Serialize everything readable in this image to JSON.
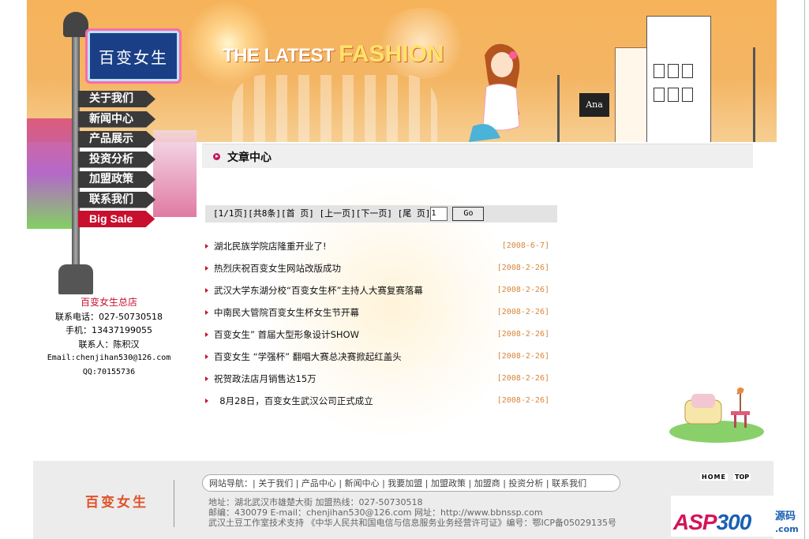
{
  "banner": {
    "tagline_a": "THE LATEST",
    "tagline_b": "FASHION",
    "shop_sign": "Ana"
  },
  "logo": {
    "text": "百变女生"
  },
  "nav": [
    {
      "label": "关于我们"
    },
    {
      "label": "新闻中心"
    },
    {
      "label": "产品展示"
    },
    {
      "label": "投资分析"
    },
    {
      "label": "加盟政策"
    },
    {
      "label": "联系我们"
    },
    {
      "label": "Big Sale"
    }
  ],
  "contact": {
    "name": "百变女生总店",
    "phone": "联系电话：027-50730518",
    "mobile": "手机：13437199055",
    "person": "联系人：陈积汉",
    "email": "Email:chenjihan530@126.com",
    "qq": "QQ:70155736"
  },
  "section": {
    "title": "文章中心"
  },
  "pager": {
    "text": "[1/1页][共8条][首 页] [上一页][下一页] [尾 页]",
    "input_value": "1",
    "go_label": "Go"
  },
  "articles": [
    {
      "title": "湖北民族学院店隆重开业了!",
      "date": "[2008-6-7]"
    },
    {
      "title": "热烈庆祝百变女生网站改版成功",
      "date": "[2008-2-26]"
    },
    {
      "title": "武汉大学东湖分校“百变女生杯”主持人大赛复赛落幕",
      "date": "[2008-2-26]"
    },
    {
      "title": "中南民大管院百变女生杯女生节开幕",
      "date": "[2008-2-26]"
    },
    {
      "title": "百变女生” 首届大型形象设计SHOW",
      "date": "[2008-2-26]"
    },
    {
      "title": "百变女生 “学强杯” 翻唱大赛总决赛掀起红盖头",
      "date": "[2008-2-26]"
    },
    {
      "title": "祝贺政法店月销售达15万",
      "date": "[2008-2-26]"
    },
    {
      "title": "  8月28日，百变女生武汉公司正式成立",
      "date": "[2008-2-26]"
    }
  ],
  "footer": {
    "brand": "百变女生",
    "nav_text": "网站导航：| 关于我们 | 产品中心 | 新闻中心 | 我要加盟 | 加盟政策 | 加盟商 | 投资分析 | 联系我们",
    "address_line": "地址：湖北武汉市雄楚大街    加盟热线：027-50730518",
    "contact_line": "邮编：430079   E-mail：chenjihan530@126.com    网址：http://www.bbnssp.com",
    "copyright_line": "武汉土豆工作室技术支持        《中华人民共和国电信与信息服务业务经营许可证》编号：鄂ICP备05029135号",
    "home_label": "HOME",
    "top_label": "TOP"
  },
  "watermark": {
    "asp": "ASP",
    "num": "300",
    "yuanma": "源码",
    "com": ".com"
  },
  "colors": {
    "accent_red": "#c8102e",
    "date_orange": "#d8853a",
    "banner_orange": "#f4b563"
  }
}
